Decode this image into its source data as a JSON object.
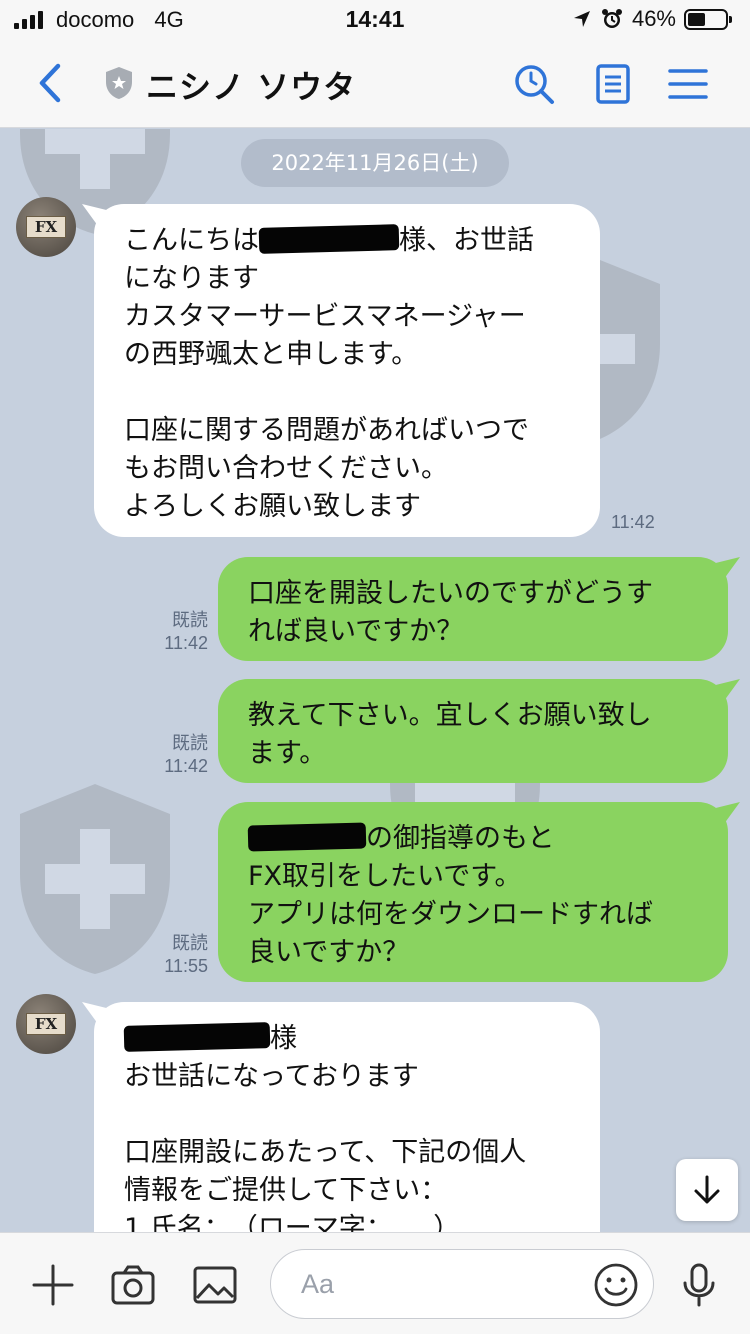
{
  "status_bar": {
    "carrier": "docomo",
    "network": "4G",
    "time": "14:41",
    "battery_percent": "46%",
    "battery_level": 0.46
  },
  "header": {
    "title": "ニシノ ソウタ",
    "accent_color": "#2f74d8"
  },
  "chat": {
    "date_chip": "2022年11月26日(土)",
    "messages": [
      {
        "side": "in",
        "text_1": "こんにちは",
        "text_2": "様、お世話\nになります\nカスタマーサービスマネージャー\nの西野颯太と申します。\n\n口座に関する問題があればいつで\nもお問い合わせください。\nよろしくお願い致します",
        "time": "11:42"
      },
      {
        "side": "out",
        "text": "口座を開設したいのですがどうす\nれば良いですか？",
        "read": "既読",
        "time": "11:42"
      },
      {
        "side": "out",
        "text": "教えて下さい。宜しくお願い致し\nます。",
        "read": "既読",
        "time": "11:42"
      },
      {
        "side": "out",
        "text_1": "の御指導のもと",
        "text_2": "FX取引をしたいです。\nアプリは何をダウンロードすれば\n良いですか？",
        "read": "既読",
        "time": "11:55"
      },
      {
        "side": "in",
        "text_1": "様",
        "text_2": "お世話になっております\n\n口座開設にあたって、下記の個人\n情報をご提供して下さい：\n1.氏名：　（ローマ字：　　）"
      }
    ],
    "avatar_label": "FX"
  },
  "input_bar": {
    "placeholder": "Aa"
  },
  "colors": {
    "chat_background": "#c6d0de",
    "outgoing_bubble": "#8ad360",
    "incoming_bubble": "#ffffff",
    "date_chip": "#b2bccb"
  }
}
